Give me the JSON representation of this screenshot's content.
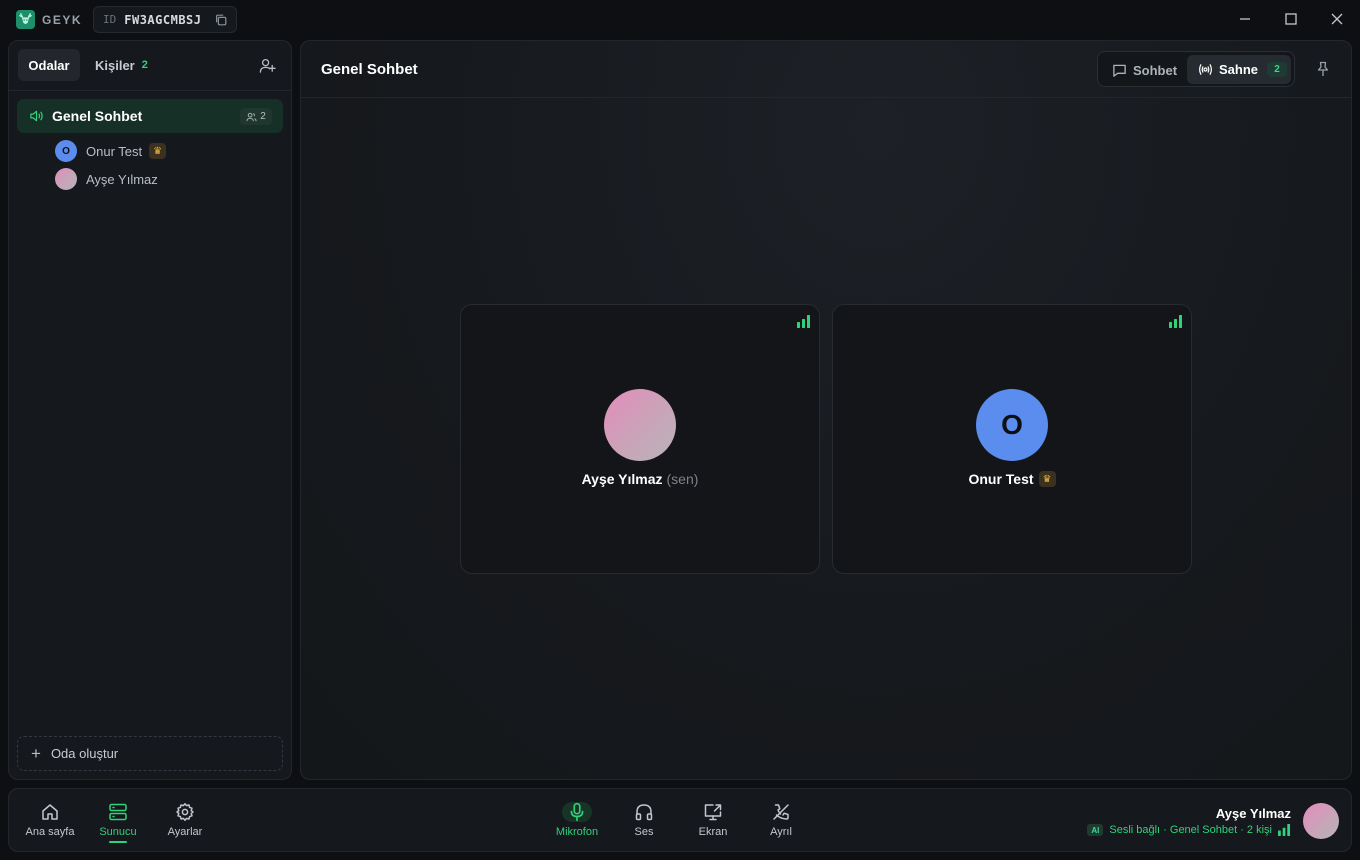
{
  "app": {
    "brand": "GEYK",
    "id_label": "ID",
    "id_value": "FW3AGCMBSJ",
    "accent_color": "#2fd27a"
  },
  "sidebar": {
    "tabs": [
      {
        "label": "Odalar",
        "active": true
      },
      {
        "label": "Kişiler",
        "count": "2",
        "active": false
      }
    ],
    "rooms": [
      {
        "name": "Genel Sohbet",
        "member_count": "2",
        "active": true,
        "members": [
          {
            "name": "Onur Test",
            "initial": "O",
            "owner": true,
            "avatar_color": "#5b8def"
          },
          {
            "name": "Ayşe Yılmaz",
            "initial": "",
            "owner": false
          }
        ]
      }
    ],
    "create_room_label": "Oda oluştur"
  },
  "main": {
    "title": "Genel Sohbet",
    "view_tabs": [
      {
        "label": "Sohbet",
        "active": false
      },
      {
        "label": "Sahne",
        "active": true,
        "count": "2"
      }
    ],
    "tiles": [
      {
        "name": "Ayşe Yılmaz",
        "suffix": "(sen)",
        "initial": "",
        "owner": false
      },
      {
        "name": "Onur Test",
        "suffix": "",
        "initial": "O",
        "owner": true
      }
    ]
  },
  "bottombar": {
    "nav": [
      {
        "label": "Ana sayfa",
        "icon": "home-icon"
      },
      {
        "label": "Sunucu",
        "icon": "server-icon",
        "active": true
      },
      {
        "label": "Ayarlar",
        "icon": "gear-icon"
      }
    ],
    "controls": [
      {
        "label": "Mikrofon",
        "icon": "microphone-icon",
        "active": true
      },
      {
        "label": "Ses",
        "icon": "headphones-icon"
      },
      {
        "label": "Ekran",
        "icon": "screen-share-icon"
      },
      {
        "label": "Ayrıl",
        "icon": "phone-off-icon"
      }
    ],
    "user": {
      "name": "Ayşe Yılmaz",
      "ai_tag": "AI",
      "status": "Sesli bağlı · Genel Sohbet · 2 kişi"
    }
  }
}
